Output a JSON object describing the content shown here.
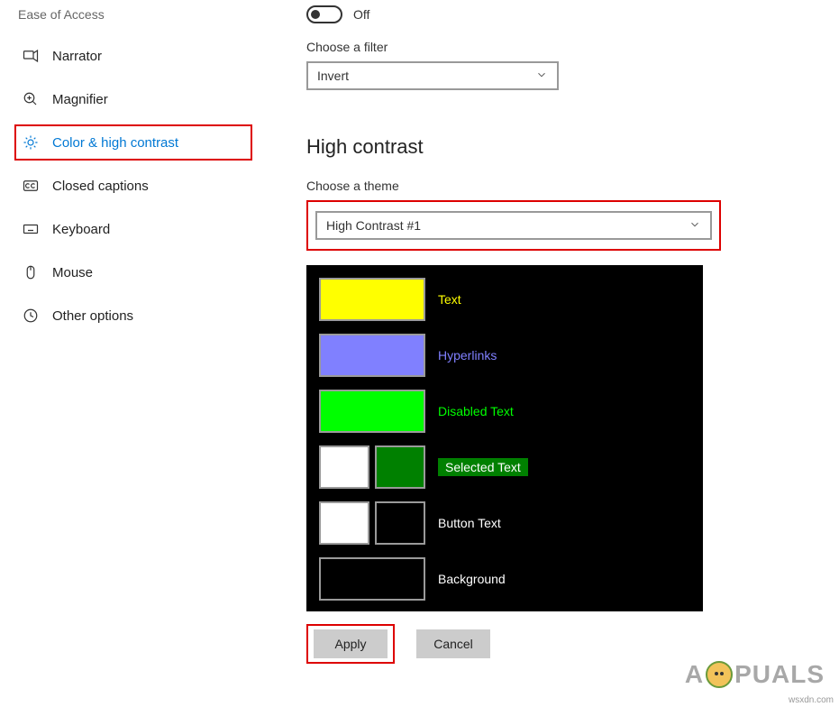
{
  "sidebar": {
    "title": "Ease of Access",
    "items": [
      {
        "label": "Narrator"
      },
      {
        "label": "Magnifier"
      },
      {
        "label": "Color & high contrast"
      },
      {
        "label": "Closed captions"
      },
      {
        "label": "Keyboard"
      },
      {
        "label": "Mouse"
      },
      {
        "label": "Other options"
      }
    ]
  },
  "filter": {
    "toggle_state": "Off",
    "label": "Choose a filter",
    "value": "Invert"
  },
  "highcontrast": {
    "heading": "High contrast",
    "theme_label": "Choose a theme",
    "theme_value": "High Contrast #1",
    "swatches": {
      "text": {
        "label": "Text",
        "color": "#ffff00",
        "label_color": "#ffff00"
      },
      "hyperlinks": {
        "label": "Hyperlinks",
        "color": "#8080ff",
        "label_color": "#8080ff"
      },
      "disabled_text": {
        "label": "Disabled Text",
        "color": "#00ff00",
        "label_color": "#00ff00"
      },
      "selected_text": {
        "label": "Selected Text",
        "fg": "#ffffff",
        "bg": "#008000"
      },
      "button_text": {
        "label": "Button Text",
        "fg": "#ffffff",
        "bg": "#000000",
        "label_color": "#ffffff"
      },
      "background": {
        "label": "Background",
        "color": "#000000",
        "label_color": "#ffffff"
      }
    }
  },
  "buttons": {
    "apply": "Apply",
    "cancel": "Cancel"
  },
  "watermark": "wsxdn.com",
  "logo_text_left": "A",
  "logo_text_right": "PUALS"
}
